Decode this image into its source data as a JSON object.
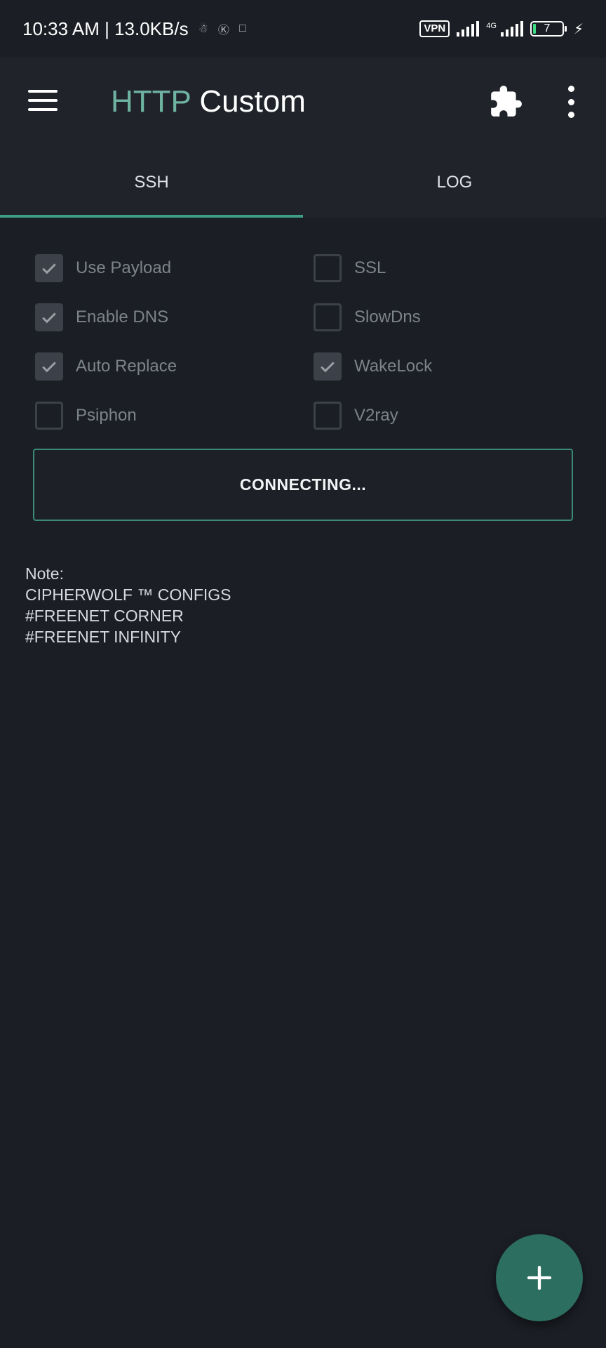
{
  "status_bar": {
    "time_speed": "10:33 AM | 13.0KB/s",
    "vpn_label": "VPN",
    "network_type": "4G",
    "battery_level": "7"
  },
  "app_bar": {
    "title_part1": "HTTP",
    "title_part2": "Custom"
  },
  "tabs": [
    {
      "label": "SSH",
      "active": true
    },
    {
      "label": "LOG",
      "active": false
    }
  ],
  "options": [
    {
      "label": "Use Payload",
      "checked": true
    },
    {
      "label": "SSL",
      "checked": false
    },
    {
      "label": "Enable DNS",
      "checked": true
    },
    {
      "label": "SlowDns",
      "checked": false
    },
    {
      "label": "Auto Replace",
      "checked": true
    },
    {
      "label": "WakeLock",
      "checked": true
    },
    {
      "label": "Psiphon",
      "checked": false
    },
    {
      "label": "V2ray",
      "checked": false
    }
  ],
  "connect_button": {
    "label": "CONNECTING..."
  },
  "note": {
    "lines": [
      "Note:",
      "CIPHERWOLF ™ CONFIGS",
      "#FREENET CORNER",
      "#FREENET INFINITY"
    ]
  },
  "colors": {
    "accent": "#3f9d86",
    "title_accent": "#6fb3a1",
    "fab": "#2c6e5f",
    "background": "#1b1e24"
  }
}
